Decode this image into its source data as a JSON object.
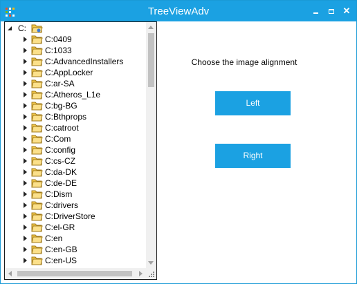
{
  "window": {
    "title": "TreeViewAdv",
    "controls": {
      "minimize": "minimize",
      "maximize": "maximize",
      "close": "✕"
    }
  },
  "tree": {
    "root": "C:",
    "items": [
      "C:0409",
      "C:1033",
      "C:AdvancedInstallers",
      "C:AppLocker",
      "C:ar-SA",
      "C:Atheros_L1e",
      "C:bg-BG",
      "C:Bthprops",
      "C:catroot",
      "C:Com",
      "C:config",
      "C:cs-CZ",
      "C:da-DK",
      "C:de-DE",
      "C:Dism",
      "C:drivers",
      "C:DriverStore",
      "C:el-GR",
      "C:en",
      "C:en-GB",
      "C:en-US"
    ]
  },
  "panel": {
    "prompt": "Choose the image alignment",
    "left_label": "Left",
    "right_label": "Right"
  },
  "colors": {
    "accent": "#1ba1e2",
    "folder": "#f5c94a"
  }
}
